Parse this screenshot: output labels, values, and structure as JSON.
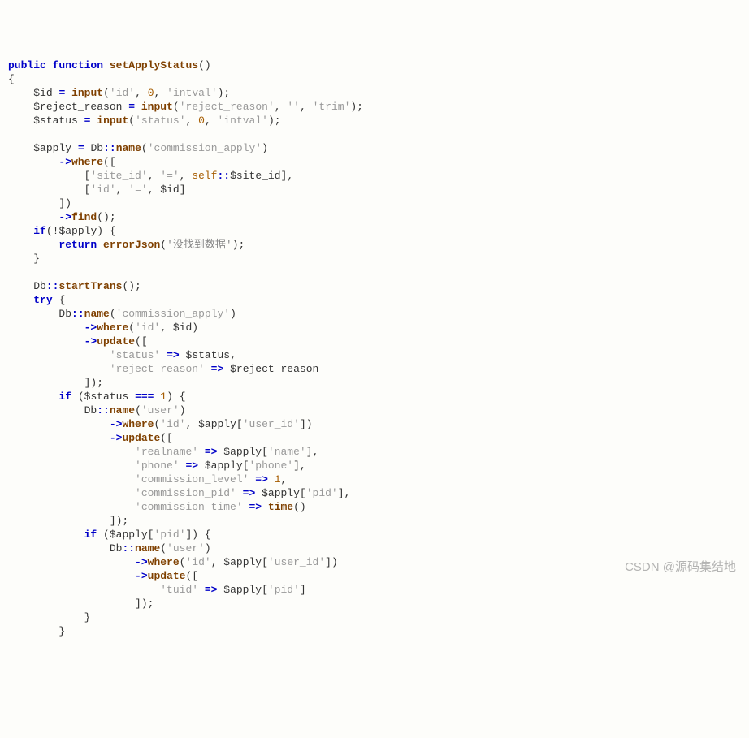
{
  "watermark": "CSDN @源码集结地",
  "code": {
    "l1": {
      "kw1": "public",
      "kw2": "function",
      "fn": "setApplyStatus"
    },
    "l3": {
      "var": "$id",
      "fn": "input",
      "s1": "'id'",
      "n": "0",
      "s2": "'intval'"
    },
    "l4": {
      "var": "$reject_reason",
      "fn": "input",
      "s1": "'reject_reason'",
      "s2": "''",
      "s3": "'trim'"
    },
    "l5": {
      "var": "$status",
      "fn": "input",
      "s1": "'status'",
      "n": "0",
      "s2": "'intval'"
    },
    "l7": {
      "var": "$apply",
      "cls": "Db",
      "fn": "name",
      "s": "'commission_apply'"
    },
    "l8": {
      "fn": "where"
    },
    "l9": {
      "s1": "'site_id'",
      "s2": "'='",
      "self": "self",
      "prop": "$site_id"
    },
    "l10": {
      "s1": "'id'",
      "s2": "'='",
      "var": "$id"
    },
    "l12": {
      "fn": "find"
    },
    "l13": {
      "kw": "if",
      "var": "$apply"
    },
    "l14": {
      "kw": "return",
      "fn": "errorJson",
      "s": "'没找到数据'"
    },
    "l17": {
      "cls": "Db",
      "fn": "startTrans"
    },
    "l18": {
      "kw": "try"
    },
    "l19": {
      "cls": "Db",
      "fn": "name",
      "s": "'commission_apply'"
    },
    "l20": {
      "fn": "where",
      "s": "'id'",
      "var": "$id"
    },
    "l21": {
      "fn": "update"
    },
    "l22": {
      "s": "'status'",
      "var": "$status"
    },
    "l23": {
      "s": "'reject_reason'",
      "var": "$reject_reason"
    },
    "l25": {
      "kw": "if",
      "var": "$status",
      "n": "1"
    },
    "l26": {
      "cls": "Db",
      "fn": "name",
      "s": "'user'"
    },
    "l27": {
      "fn": "where",
      "s": "'id'",
      "var": "$apply",
      "k": "'user_id'"
    },
    "l28": {
      "fn": "update"
    },
    "l29": {
      "s": "'realname'",
      "var": "$apply",
      "k": "'name'"
    },
    "l30": {
      "s": "'phone'",
      "var": "$apply",
      "k": "'phone'"
    },
    "l31": {
      "s": "'commission_level'",
      "n": "1"
    },
    "l32": {
      "s": "'commission_pid'",
      "var": "$apply",
      "k": "'pid'"
    },
    "l33": {
      "s": "'commission_time'",
      "fn": "time"
    },
    "l35": {
      "kw": "if",
      "var": "$apply",
      "k": "'pid'"
    },
    "l36": {
      "cls": "Db",
      "fn": "name",
      "s": "'user'"
    },
    "l37": {
      "fn": "where",
      "s": "'id'",
      "var": "$apply",
      "k": "'user_id'"
    },
    "l38": {
      "fn": "update"
    },
    "l39": {
      "s": "'tuid'",
      "var": "$apply",
      "k": "'pid'"
    }
  }
}
